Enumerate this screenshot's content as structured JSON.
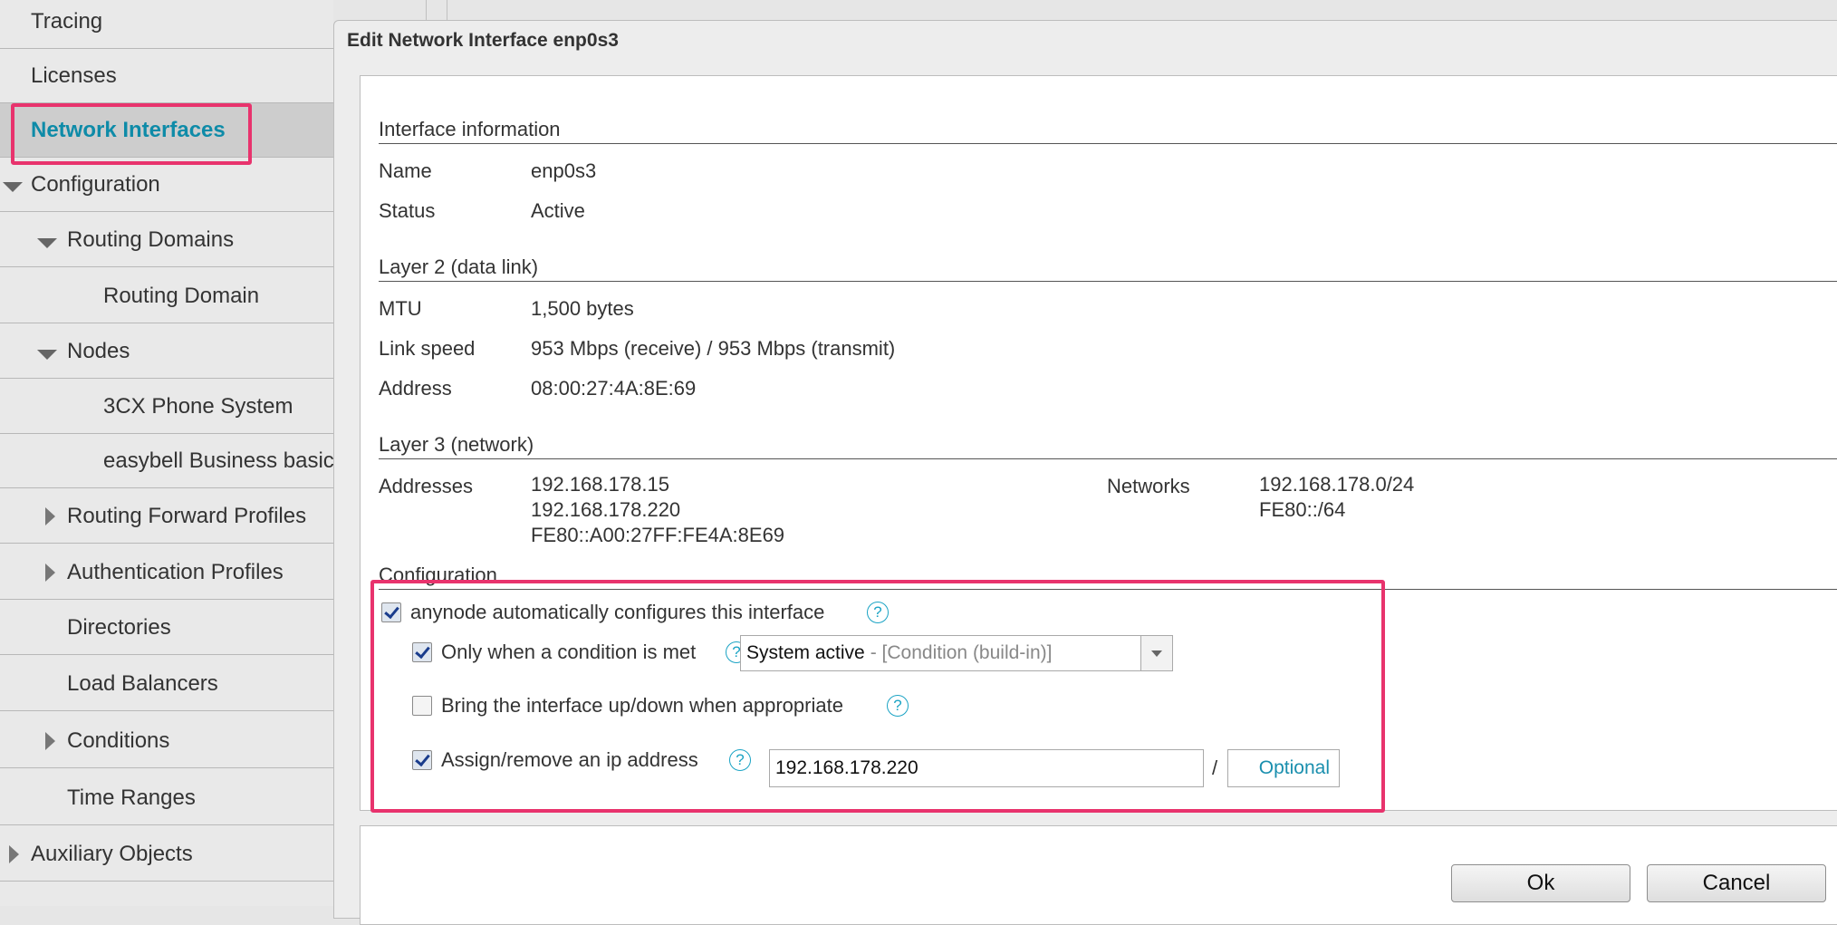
{
  "sidebar": {
    "items": [
      {
        "label": "Tracing"
      },
      {
        "label": "Licenses"
      },
      {
        "label": "Network Interfaces"
      },
      {
        "label": "Configuration"
      },
      {
        "label": "Routing Domains"
      },
      {
        "label": "Routing Domain"
      },
      {
        "label": "Nodes"
      },
      {
        "label": "3CX Phone System"
      },
      {
        "label": "easybell Business basic"
      },
      {
        "label": "Routing Forward Profiles"
      },
      {
        "label": "Authentication Profiles"
      },
      {
        "label": "Directories"
      },
      {
        "label": "Load Balancers"
      },
      {
        "label": "Conditions"
      },
      {
        "label": "Time Ranges"
      },
      {
        "label": "Auxiliary Objects"
      }
    ]
  },
  "dialog": {
    "title": "Edit Network Interface enp0s3",
    "interface_info": {
      "section": "Interface information",
      "name_label": "Name",
      "name_value": "enp0s3",
      "status_label": "Status",
      "status_value": "Active"
    },
    "layer2": {
      "section": "Layer 2 (data link)",
      "mtu_label": "MTU",
      "mtu_value": "1,500 bytes",
      "speed_label": "Link speed",
      "speed_value": "953 Mbps (receive) / 953 Mbps (transmit)",
      "address_label": "Address",
      "address_value": "08:00:27:4A:8E:69"
    },
    "layer3": {
      "section": "Layer 3 (network)",
      "addresses_label": "Addresses",
      "addresses": [
        "192.168.178.15",
        "192.168.178.220",
        "FE80::A00:27FF:FE4A:8E69"
      ],
      "networks_label": "Networks",
      "networks": [
        "192.168.178.0/24",
        "FE80::/64"
      ]
    },
    "configuration": {
      "section": "Configuration",
      "auto_configure": {
        "label": "anynode automatically configures this interface",
        "checked": true
      },
      "condition": {
        "label": "Only when a condition is met",
        "checked": true,
        "selected": "System active",
        "selected_type": "- [Condition (build-in)]"
      },
      "updown": {
        "label": "Bring the interface up/down when appropriate",
        "checked": false
      },
      "assign_ip": {
        "label": "Assign/remove an ip address",
        "checked": true,
        "ip_value": "192.168.178.220",
        "separator": "/",
        "prefix_placeholder": "Optional"
      },
      "help_glyph": "?"
    },
    "buttons": {
      "ok": "Ok",
      "cancel": "Cancel"
    }
  },
  "colors": {
    "accent": "#0e8ba8",
    "highlight": "#e8336d",
    "help": "#1aa3c4"
  }
}
